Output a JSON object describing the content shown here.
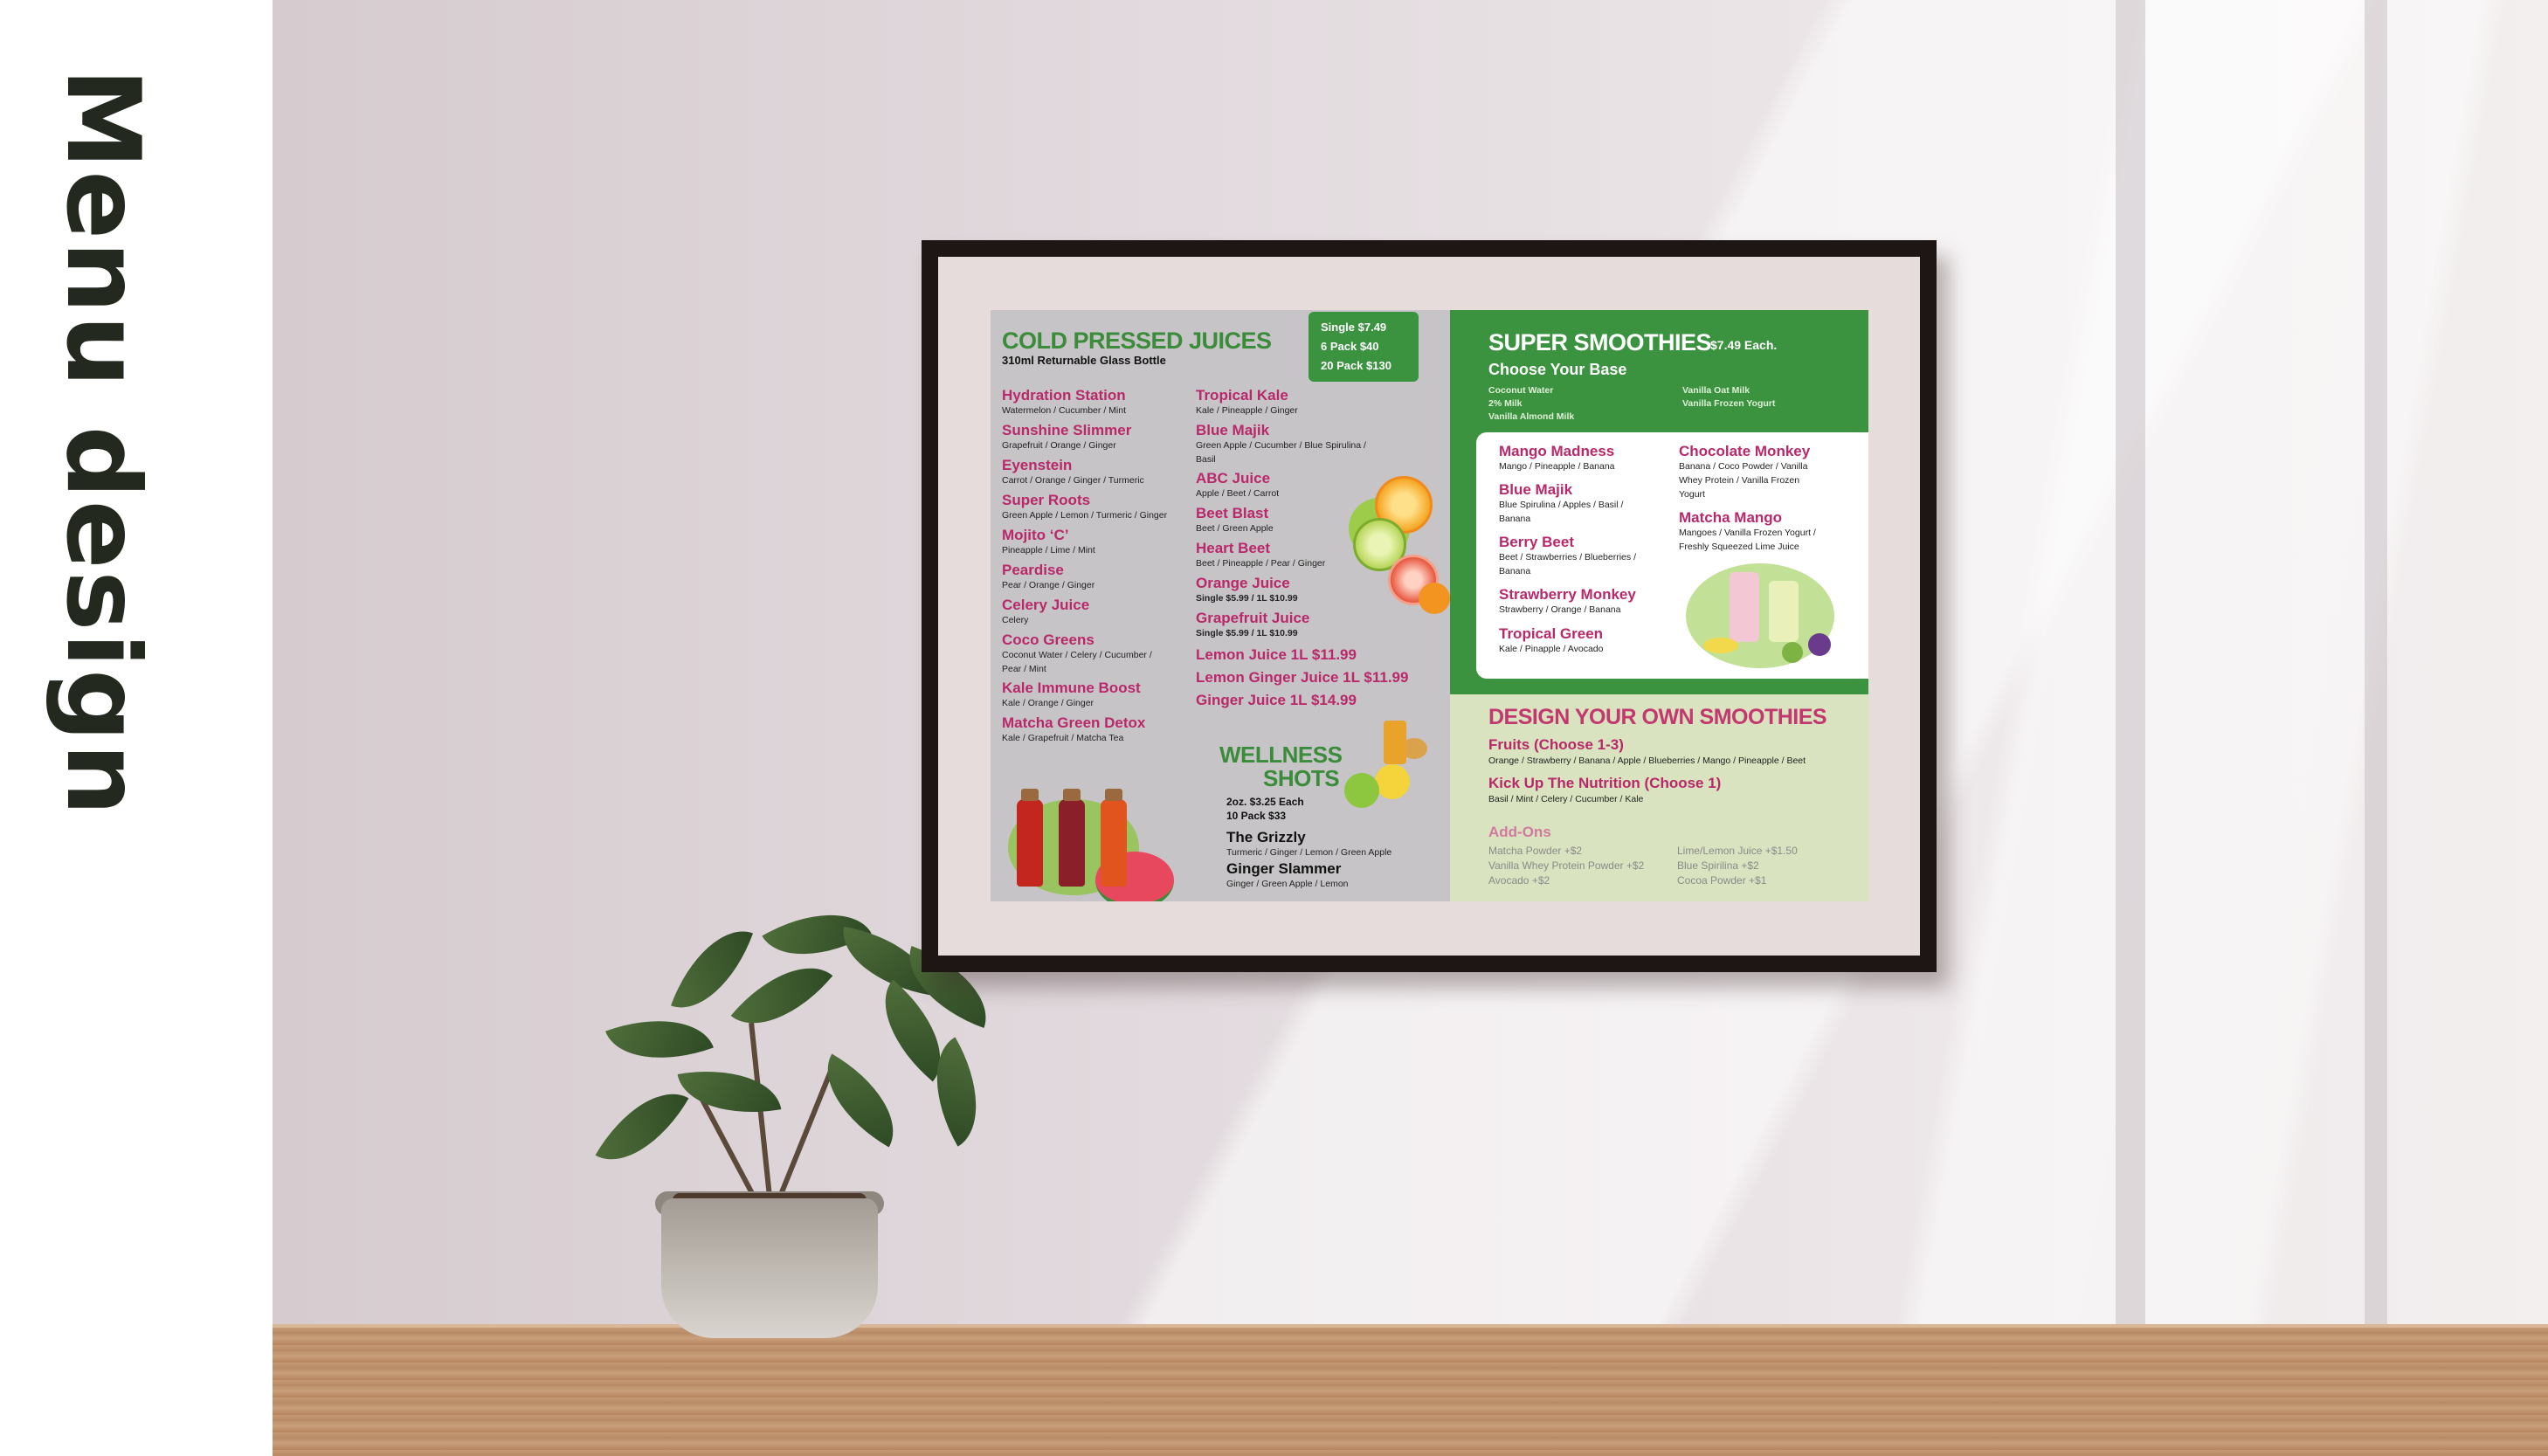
{
  "side_title": "Menu design",
  "menu": {
    "cold": {
      "title": "COLD PRESSED JUICES",
      "subtitle": "310ml Returnable Glass Bottle",
      "pricing": [
        "Single $7.49",
        "6 Pack $40",
        "20 Pack $130"
      ],
      "col1": [
        {
          "name": "Hydration Station",
          "desc": "Watermelon / Cucumber / Mint"
        },
        {
          "name": "Sunshine Slimmer",
          "desc": "Grapefruit / Orange / Ginger"
        },
        {
          "name": "Eyenstein",
          "desc": "Carrot / Orange / Ginger / Turmeric"
        },
        {
          "name": "Super Roots",
          "desc": "Green Apple / Lemon / Turmeric / Ginger"
        },
        {
          "name": "Mojito ‘C’",
          "desc": "Pineapple / Lime / Mint"
        },
        {
          "name": "Peardise",
          "desc": "Pear / Orange / Ginger"
        },
        {
          "name": "Celery Juice",
          "desc": "Celery"
        },
        {
          "name": "Coco Greens",
          "desc": "Coconut Water / Celery / Cucumber /",
          "desc2": "Pear / Mint"
        },
        {
          "name": "Kale Immune Boost",
          "desc": "Kale / Orange / Ginger"
        },
        {
          "name": "Matcha Green Detox",
          "desc": "Kale / Grapefruit / Matcha Tea"
        }
      ],
      "col2": [
        {
          "name": "Tropical Kale",
          "desc": "Kale / Pineapple / Ginger"
        },
        {
          "name": "Blue Majik",
          "desc": "Green Apple / Cucumber / Blue Spirulina /",
          "desc2": "Basil"
        },
        {
          "name": "ABC Juice",
          "desc": "Apple / Beet / Carrot"
        },
        {
          "name": "Beet Blast",
          "desc": "Beet / Green Apple"
        },
        {
          "name": "Heart Beet",
          "desc": "Beet / Pineapple / Pear / Ginger"
        },
        {
          "name": "Orange Juice",
          "desc": "Single $5.99 / 1L $10.99"
        },
        {
          "name": "Grapefruit Juice",
          "desc": "Single $5.99 / 1L $10.99"
        }
      ],
      "liters": [
        "Lemon Juice 1L $11.99",
        "Lemon Ginger Juice 1L $11.99",
        "Ginger Juice 1L $14.99"
      ]
    },
    "wellness": {
      "title1": "WELLNESS",
      "title2": "SHOTS",
      "price1": "2oz. $3.25 Each",
      "price2": "10 Pack $33",
      "items": [
        {
          "name": "The Grizzly",
          "desc": "Turmeric / Ginger / Lemon / Green Apple"
        },
        {
          "name": "Ginger Slammer",
          "desc": "Ginger / Green Apple / Lemon"
        }
      ]
    },
    "smoothies": {
      "title": "SUPER SMOOTHIES",
      "price": "$7.49 Each.",
      "base_label": "Choose Your Base",
      "bases_left": [
        "Coconut Water",
        "2% Milk",
        "Vanilla Almond Milk"
      ],
      "bases_right": [
        "Vanilla Oat Milk",
        "Vanilla Frozen Yogurt"
      ],
      "col1": [
        {
          "name": "Mango Madness",
          "desc": [
            "Mango / Pineapple / Banana"
          ]
        },
        {
          "name": "Blue Majik",
          "desc": [
            "Blue Spirulina / Apples / Basil /",
            "Banana"
          ]
        },
        {
          "name": "Berry Beet",
          "desc": [
            "Beet / Strawberries / Blueberries /",
            "Banana"
          ]
        },
        {
          "name": "Strawberry Monkey",
          "desc": [
            "Strawberry / Orange / Banana"
          ]
        },
        {
          "name": "Tropical Green",
          "desc": [
            "Kale / Pinapple / Avocado"
          ]
        }
      ],
      "col2": [
        {
          "name": "Chocolate Monkey",
          "desc": [
            "Banana / Coco Powder / Vanilla",
            "Whey Protein / Vanilla Frozen",
            "Yogurt"
          ]
        },
        {
          "name": "Matcha Mango",
          "desc": [
            "Mangoes / Vanilla Frozen Yogurt /",
            "Freshly Squeezed Lime Juice"
          ]
        }
      ]
    },
    "diy": {
      "title": "DESIGN YOUR OWN SMOOTHIES",
      "fruits_label": "Fruits (Choose 1-3)",
      "fruits": "Orange / Strawberry / Banana / Apple / Blueberries / Mango / Pineapple / Beet",
      "kick_label": "Kick Up The Nutrition (Choose 1)",
      "kick": "Basil / Mint / Celery / Cucumber / Kale",
      "addons_label": "Add-Ons",
      "addons_left": [
        "Matcha Powder +$2",
        "Vanilla Whey Protein Powder +$2",
        "Avocado +$2"
      ],
      "addons_right": [
        "Lime/Lemon Juice +$1.50",
        "Blue Spirilina +$2",
        "Cocoa Powder +$1"
      ]
    }
  },
  "colors": {
    "green": "#3b9340",
    "pink": "#b8286a",
    "title_dark": "#23291f"
  }
}
